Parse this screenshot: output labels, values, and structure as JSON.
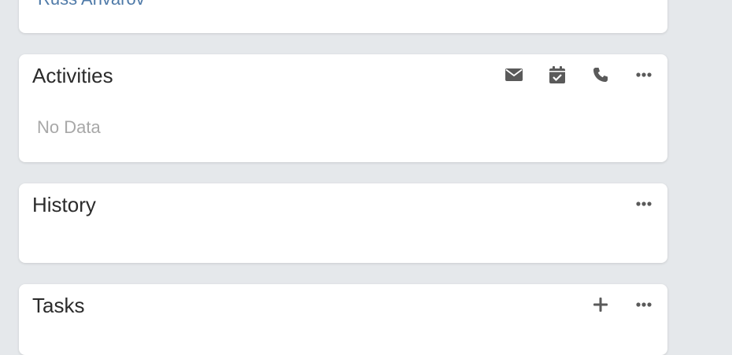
{
  "contact_panel": {
    "link_text": "Russ Anvarov"
  },
  "activities": {
    "title": "Activities",
    "empty_text": "No Data",
    "actions": {
      "email_icon": "envelope-icon",
      "calendar_icon": "calendar-check-icon",
      "phone_icon": "phone-icon",
      "more_icon": "ellipsis-icon"
    }
  },
  "history": {
    "title": "History",
    "actions": {
      "more_icon": "ellipsis-icon"
    }
  },
  "tasks": {
    "title": "Tasks",
    "actions": {
      "add_icon": "plus-icon",
      "more_icon": "ellipsis-icon"
    }
  },
  "colors": {
    "page_background": "#e5e8eb",
    "panel_background": "#ffffff",
    "link": "#4f7aa8",
    "title": "#2b2b2b",
    "muted": "#a8a8a8",
    "icon": "#5a5a5a"
  }
}
